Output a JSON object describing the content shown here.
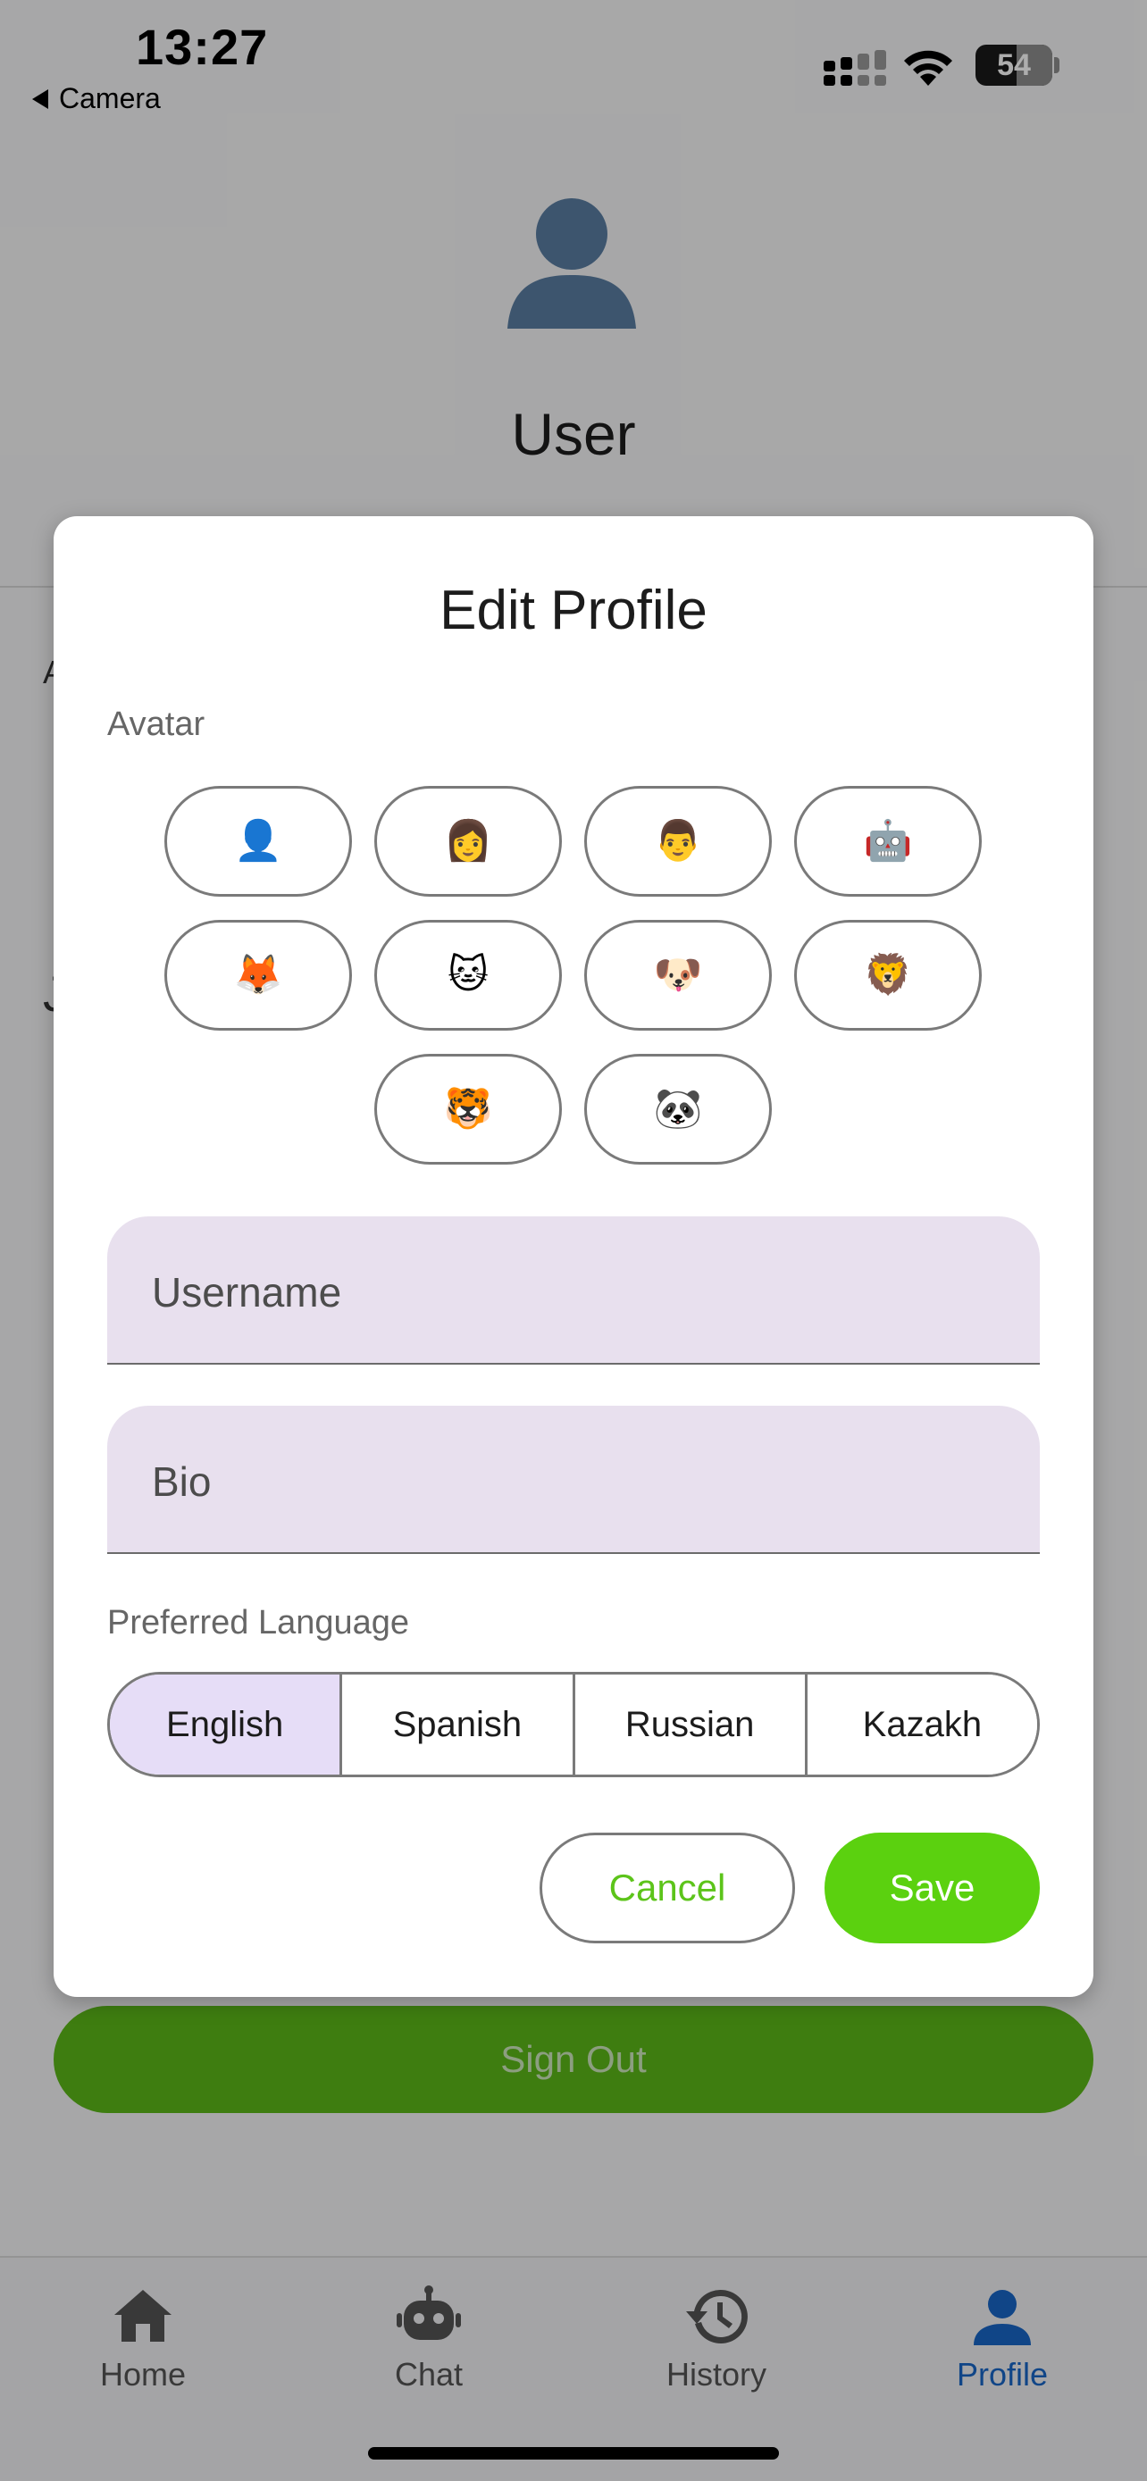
{
  "status_bar": {
    "time": "13:27",
    "back_label": "Camera",
    "battery": "54"
  },
  "profile": {
    "name": "User",
    "avatar_icon": "person-silhouette-icon",
    "stub_a": "A",
    "stub_b": "J"
  },
  "sign_out": {
    "label": "Sign Out"
  },
  "bottom_nav": {
    "items": [
      {
        "label": "Home",
        "icon": "home-icon"
      },
      {
        "label": "Chat",
        "icon": "robot-icon"
      },
      {
        "label": "History",
        "icon": "history-icon"
      },
      {
        "label": "Profile",
        "icon": "person-icon",
        "active": true
      }
    ]
  },
  "dialog": {
    "title": "Edit Profile",
    "avatar_label": "Avatar",
    "avatars": [
      "👤",
      "👩",
      "👨",
      "🤖",
      "🦊",
      "🐱",
      "🐶",
      "🦁",
      "🐯",
      "🐼"
    ],
    "username_label": "Username",
    "bio_label": "Bio",
    "language_label": "Preferred Language",
    "languages": [
      "English",
      "Spanish",
      "Russian",
      "Kazakh"
    ],
    "selected_language": "English",
    "cancel_label": "Cancel",
    "save_label": "Save"
  },
  "colors": {
    "accent_green": "#5bd10f",
    "nav_active": "#1866c7",
    "field_bg": "#e8e0ee",
    "selected_segment": "#e6ddf7"
  }
}
